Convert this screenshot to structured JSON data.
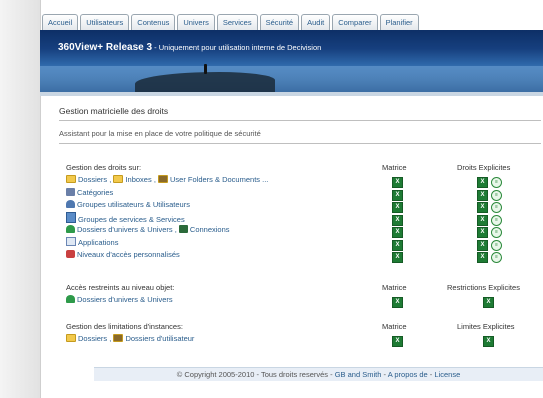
{
  "tabs": [
    "Accueil",
    "Utilisateurs",
    "Contenus",
    "Univers",
    "Services",
    "Sécurité",
    "Audit",
    "Comparer",
    "Planifier"
  ],
  "banner": {
    "title": "360View+ Release 3",
    "subtitle": " - Uniquement pour utilisation interne de Decivision"
  },
  "page": {
    "title": "Gestion matricielle des droits",
    "subtitle": "Assistant pour la mise en place de votre politique de sécurité"
  },
  "sections": {
    "droits": {
      "heading": "Gestion des droits sur:",
      "col1": "Matrice",
      "col2": "Droits Explicites",
      "rows": [
        {
          "items": [
            "Dossiers",
            "Inboxes",
            "User Folders & Documents ..."
          ],
          "seps": [
            " , ",
            " , "
          ]
        },
        {
          "items": [
            "Catégories"
          ],
          "seps": []
        },
        {
          "items": [
            "Groupes utilisateurs & Utilisateurs"
          ],
          "seps": []
        },
        {
          "items": [
            "Groupes de services & Services"
          ],
          "seps": []
        },
        {
          "items": [
            "Dossiers d'univers & Univers",
            "Connexions"
          ],
          "seps": [
            " , "
          ]
        },
        {
          "items": [
            "Applications"
          ],
          "seps": []
        },
        {
          "items": [
            "Niveaux d'accès personnalisés"
          ],
          "seps": []
        }
      ]
    },
    "acces": {
      "heading": "Accès restreints au niveau objet:",
      "col1": "Matrice",
      "col2": "Restrictions Explicites",
      "rows": [
        {
          "items": [
            "Dossiers d'univers & Univers"
          ],
          "seps": []
        }
      ]
    },
    "limites": {
      "heading": "Gestion des limitations d'instances:",
      "col1": "Matrice",
      "col2": "Limites Explicites",
      "rows": [
        {
          "items": [
            "Dossiers",
            "Dossiers d'utilisateur"
          ],
          "seps": [
            " , "
          ]
        }
      ]
    }
  },
  "footer": {
    "copyright": "© Copyright 2005-2010 - Tous droits reservés - ",
    "author": "GB and Smith",
    "sep": " - ",
    "about": "A propos de",
    "sep2": " - ",
    "license": "License"
  }
}
